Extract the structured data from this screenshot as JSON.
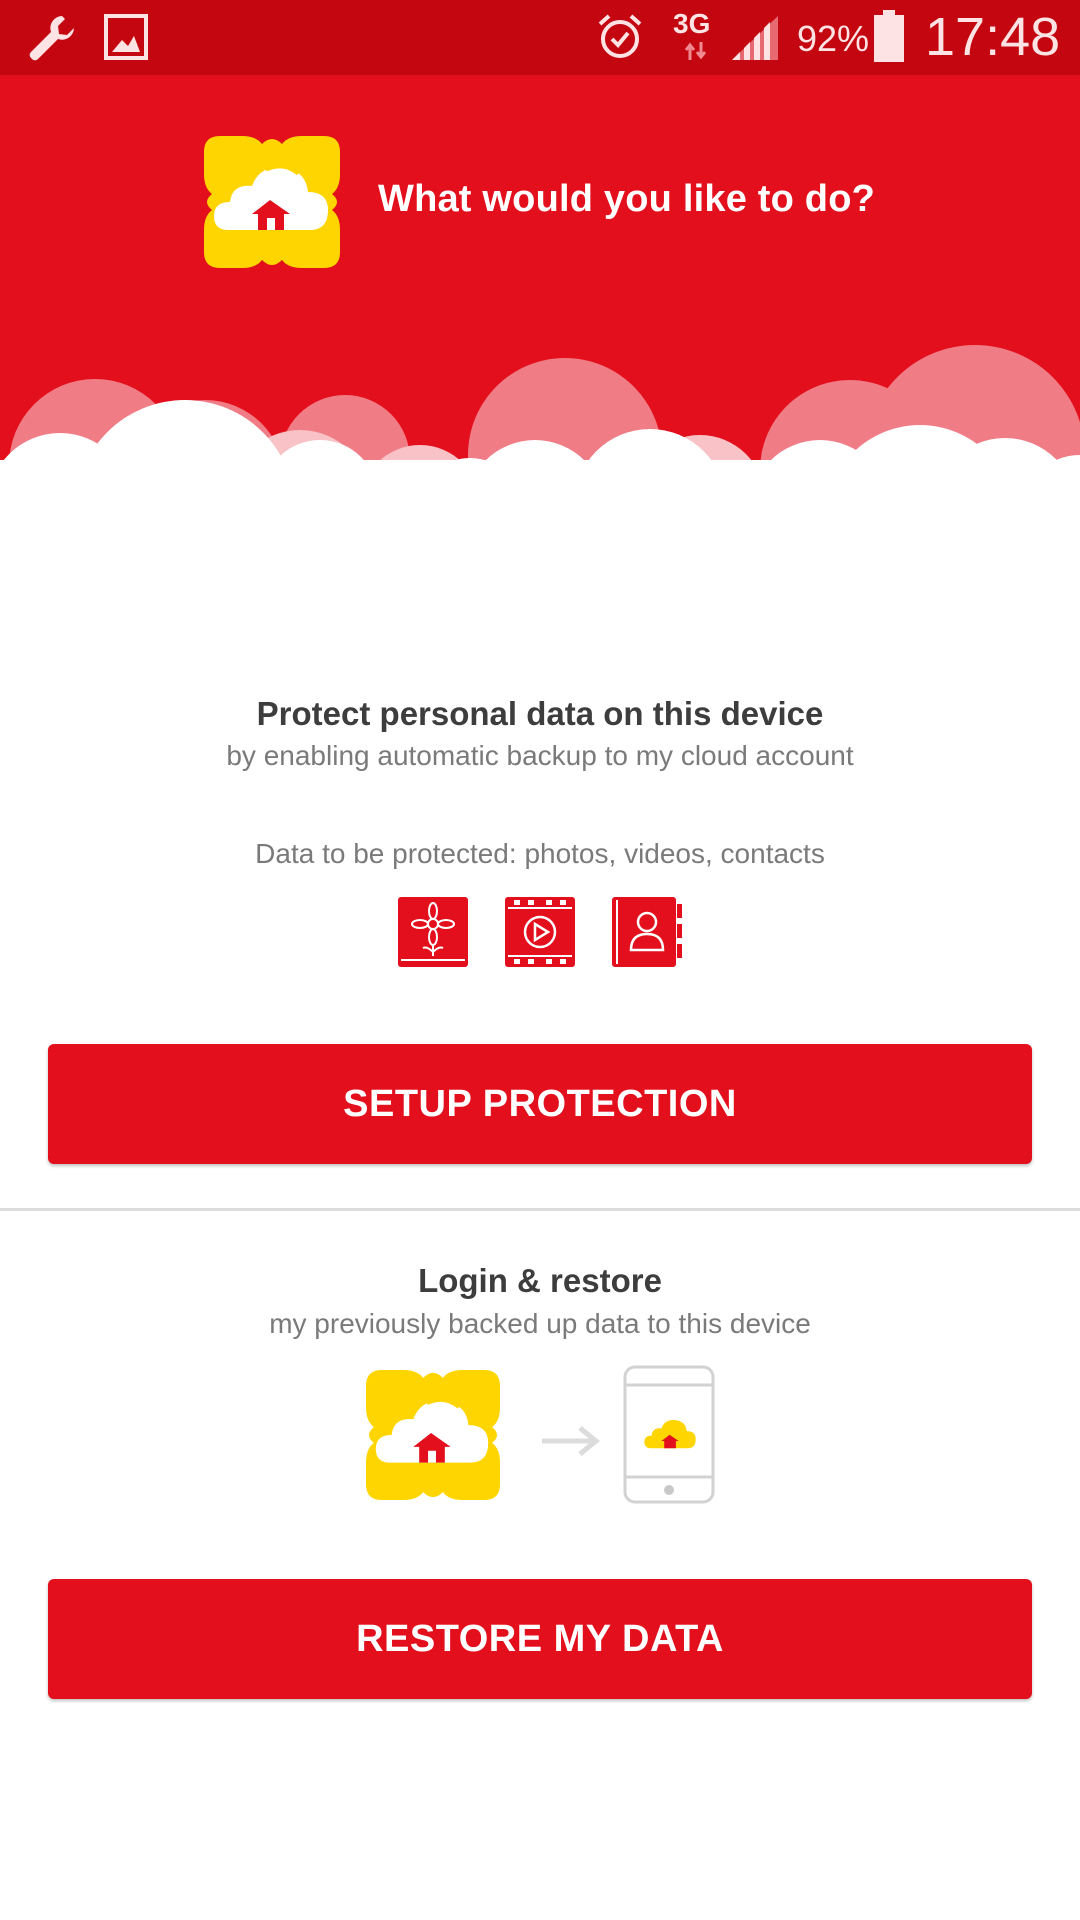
{
  "statusbar": {
    "battery": "92%",
    "network": "3G",
    "time": "17:48"
  },
  "header": {
    "title": "What would you like to do?"
  },
  "protect": {
    "title": "Protect personal data on this device",
    "subtitle": "by enabling automatic backup to my cloud account",
    "data_label": "Data to be protected: photos, videos, contacts",
    "icons": [
      "photos-icon",
      "videos-icon",
      "contacts-icon"
    ],
    "button_label": "SETUP PROTECTION"
  },
  "restore": {
    "title": "Login & restore",
    "subtitle": "my previously backed up data to this device",
    "button_label": "RESTORE MY DATA"
  },
  "colors": {
    "brand_red": "#e30f1c",
    "statusbar_red": "#c40611",
    "logo_yellow": "#ffd500"
  }
}
